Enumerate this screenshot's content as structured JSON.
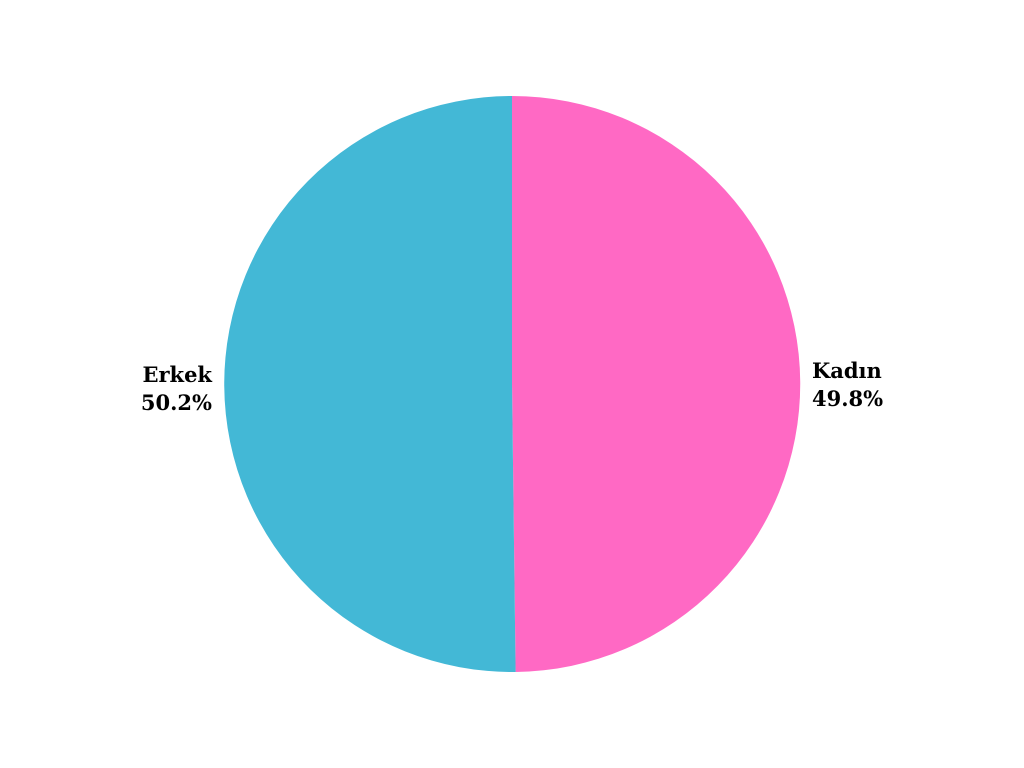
{
  "chart_data": {
    "type": "pie",
    "title": "",
    "slices": [
      {
        "label": "Kadın",
        "value": 49.8,
        "percent_label": "49.8%",
        "color": "#FF69C4"
      },
      {
        "label": "Erkek",
        "value": 50.2,
        "percent_label": "50.2%",
        "color": "#43B8D6"
      }
    ],
    "start_angle_deg": 0,
    "direction": "clockwise",
    "labels_position": "outside"
  }
}
